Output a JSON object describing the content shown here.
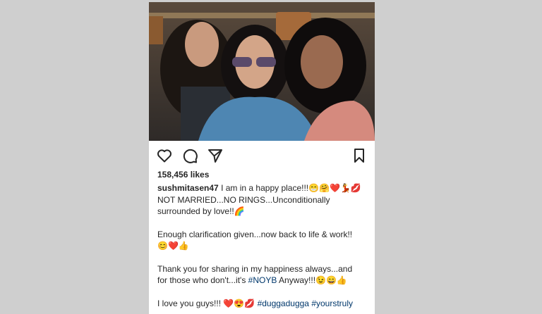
{
  "post": {
    "likes": "158,456 likes",
    "username": "sushmitasen47",
    "caption": {
      "line1": "I am in a happy place!!!😁🤗❤️💃💋",
      "line2": "NOT MARRIED...NO RINGS...Unconditionally",
      "line3": "surrounded by love!!🌈",
      "para2_line1": "Enough clarification given...now back to life & work!!",
      "para2_line2": "😊❤️👍",
      "para3_line1": "Thank you for sharing in my happiness always...and",
      "para3_line2_a": "for those who don't...it's",
      "para3_hashtag": "#NOYB",
      "para3_line2_b": "Anyway!!!😉😄👍",
      "para4_a": "I love you guys!!! ❤️😍💋",
      "para4_tag1": "#duggadugga",
      "para4_tag2": "#yourstruly"
    },
    "icons": {
      "like": "heart-icon",
      "comment": "comment-icon",
      "share": "send-icon",
      "save": "bookmark-icon"
    }
  }
}
